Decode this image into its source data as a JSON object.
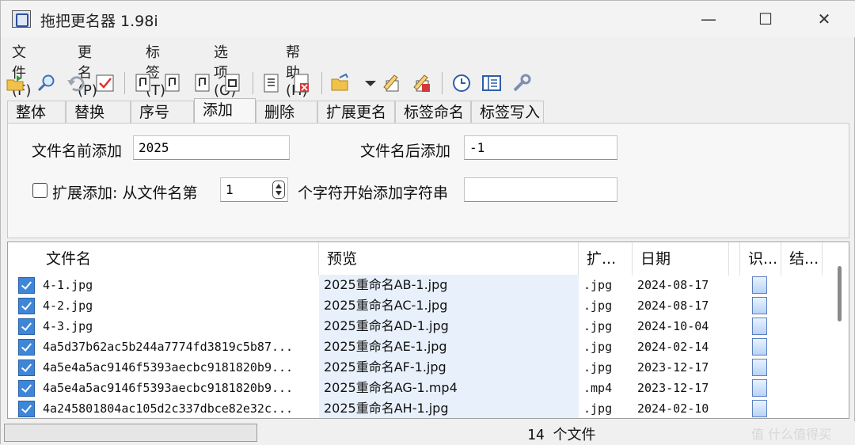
{
  "window": {
    "title": "拖把更名器 1.98i",
    "controls": {
      "minimize": "—",
      "maximize": "☐",
      "close": "✕"
    }
  },
  "menu": [
    "文件(F)",
    "更名(P)",
    "标签(T)",
    "选项(O)",
    "帮助(H)"
  ],
  "toolbar": [
    "open-folder-icon",
    "search-icon",
    "undo-icon",
    "check-icon",
    "music-tag-1-icon",
    "music-tag-2-icon",
    "music-tag-3-icon",
    "music-tag-4-icon",
    "document-icon",
    "document-delete-icon",
    "folder-open-icon",
    "dropdown-arrow-icon",
    "edit-tag-icon",
    "delete-tag-icon",
    "clock-icon",
    "panel-icon",
    "tools-icon"
  ],
  "tabs": [
    "整体",
    "替换",
    "序号",
    "添加",
    "删除",
    "扩展更名",
    "标签命名",
    "标签写入"
  ],
  "active_tab": "添加",
  "form": {
    "prefix_label": "文件名前添加",
    "prefix_value": "2025",
    "suffix_label": "文件名后添加",
    "suffix_value": "-1",
    "ext_add_label": "扩展添加: 从文件名第",
    "position_value": "1",
    "position_suffix_label": "个字符开始添加字符串",
    "insert_value": "",
    "ext_add_checked": false
  },
  "list": {
    "columns": [
      "文件名",
      "预览",
      "扩...",
      "日期",
      "识...",
      "结..."
    ],
    "rows": [
      {
        "name": "4-1.jpg",
        "preview": "2025重命名AB-1.jpg",
        "ext": ".jpg",
        "date": "2024-08-17"
      },
      {
        "name": "4-2.jpg",
        "preview": "2025重命名AC-1.jpg",
        "ext": ".jpg",
        "date": "2024-08-17"
      },
      {
        "name": "4-3.jpg",
        "preview": "2025重命名AD-1.jpg",
        "ext": ".jpg",
        "date": "2024-10-04"
      },
      {
        "name": "4a5d37b62ac5b244a7774fd3819c5b87...",
        "preview": "2025重命名AE-1.jpg",
        "ext": ".jpg",
        "date": "2024-02-14"
      },
      {
        "name": "4a5e4a5ac9146f5393aecbc9181820b9...",
        "preview": "2025重命名AF-1.jpg",
        "ext": ".jpg",
        "date": "2023-12-17"
      },
      {
        "name": "4a5e4a5ac9146f5393aecbc9181820b9...",
        "preview": "2025重命名AG-1.mp4",
        "ext": ".mp4",
        "date": "2023-12-17"
      },
      {
        "name": "4a245801804ac105d2c337dbce82e32c...",
        "preview": "2025重命名AH-1.jpg",
        "ext": ".jpg",
        "date": "2024-02-10"
      }
    ]
  },
  "status": {
    "file_count": "14 个文件",
    "watermark": "值 什么值得买"
  }
}
